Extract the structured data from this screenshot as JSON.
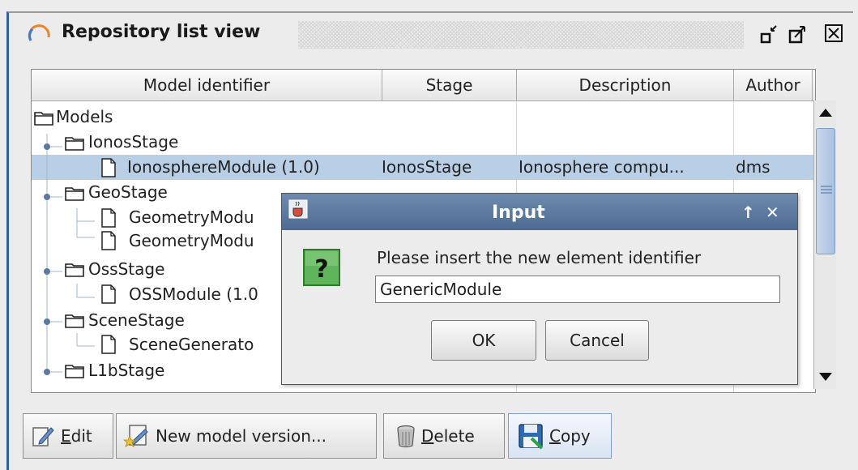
{
  "panel": {
    "title": "Repository list view",
    "controls": [
      "minimize",
      "maximize",
      "close"
    ]
  },
  "table": {
    "columns": [
      "Model identifier",
      "Stage",
      "Description",
      "Author"
    ],
    "rows": [
      {
        "label": "Models",
        "stage": "",
        "description": "",
        "author": ""
      },
      {
        "label": "IonosStage",
        "stage": "",
        "description": "",
        "author": ""
      },
      {
        "label": "IonosphereModule (1.0)",
        "stage": "IonosStage",
        "description": "Ionosphere compu...",
        "author": "dms"
      },
      {
        "label": "GeoStage",
        "stage": "",
        "description": "",
        "author": ""
      },
      {
        "label": "GeometryModu",
        "stage": "",
        "description": "",
        "author": ""
      },
      {
        "label": "GeometryModu",
        "stage": "",
        "description": "",
        "author": ""
      },
      {
        "label": "OssStage",
        "stage": "",
        "description": "",
        "author": ""
      },
      {
        "label": "OSSModule (1.0",
        "stage": "",
        "description": "",
        "author": ""
      },
      {
        "label": "SceneStage",
        "stage": "",
        "description": "",
        "author": ""
      },
      {
        "label": "SceneGenerato",
        "stage": "",
        "description": "",
        "author": ""
      },
      {
        "label": "L1bStage",
        "stage": "",
        "description": "",
        "author": ""
      }
    ],
    "selected_row": 2
  },
  "dialog": {
    "title": "Input",
    "message": "Please insert the new element identifier",
    "input_value": "GenericModule",
    "ok_label": "OK",
    "cancel_label": "Cancel",
    "title_controls": [
      "↑",
      "✕"
    ]
  },
  "toolbar": {
    "edit": {
      "underline": "E",
      "rest": "dit"
    },
    "new_version": "New model version...",
    "delete": {
      "underline": "D",
      "rest": "elete"
    },
    "copy": {
      "underline": "C",
      "rest": "opy"
    }
  },
  "colors": {
    "selection": "#b8cfe6",
    "dialog_title": "#5a769c",
    "panel_border": "#2f5fa8"
  },
  "icons": [
    "spinner-icon",
    "folder-icon",
    "file-icon",
    "question-icon",
    "edit-icon",
    "new-version-icon",
    "trash-icon",
    "save-icon"
  ]
}
